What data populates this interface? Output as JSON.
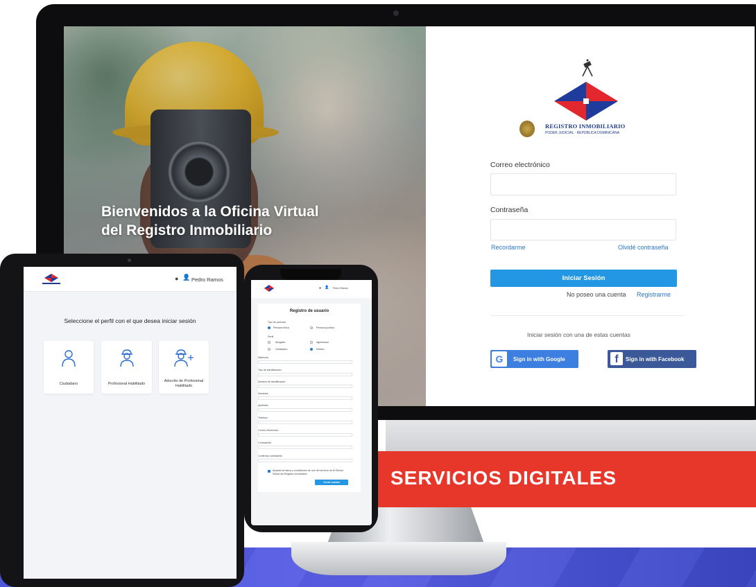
{
  "banner": {
    "text": "SERVICIOS DIGITALES"
  },
  "monitor": {
    "welcome_line1": "Bienvenidos a la Oficina Virtual",
    "welcome_line2": "del Registro Inmobiliario",
    "logo": {
      "title": "REGISTRO INMOBILIARIO",
      "subtitle": "PODER JUDICIAL · REPÚBLICA DOMINICANA"
    },
    "login": {
      "email_label": "Correo electrónico",
      "email_value": "",
      "password_label": "Contraseña",
      "password_value": "",
      "remember_label": "Recordarme",
      "forgot_label": "Olvidé contraseña",
      "submit_label": "Iniciar Sesión",
      "no_account_text": "No poseo una cuenta",
      "register_label": "Registrarme",
      "alt_login_text": "Iniciar sesión con una de estas cuentas",
      "google_label": "Sign in with Google",
      "facebook_label": "Sign in with Facebook"
    },
    "colors": {
      "primary": "#2396e4",
      "link": "#2a76c9",
      "banner": "#e7372b",
      "facebook": "#3b5998"
    }
  },
  "tablet": {
    "user_name": "Pedro Ramos",
    "heading": "Seleccione el perfil con el que desea iniciar sesión",
    "profiles": [
      {
        "icon": "person-icon",
        "label": "Ciudadano"
      },
      {
        "icon": "worker-icon",
        "label": "Profesional Habilitado"
      },
      {
        "icon": "add-worker-icon",
        "label": "Adscrito de Profesional Habilitado"
      }
    ]
  },
  "phone": {
    "user_name": "Pedro Ramos",
    "form_title": "Registro de usuario",
    "person_type_label": "Tipo de persona",
    "person_types": [
      {
        "label": "Persona física",
        "selected": true
      },
      {
        "label": "Persona jurídica",
        "selected": false
      }
    ],
    "profile_label": "Perfil",
    "profiles": [
      {
        "label": "Abogado",
        "selected": false
      },
      {
        "label": "Agrimensor",
        "selected": false
      },
      {
        "label": "Ciudadano",
        "selected": false
      },
      {
        "label": "Notario",
        "selected": true
      }
    ],
    "fields": [
      "Matrícula",
      "Tipo de identificación",
      "Número de identificación",
      "Nombres",
      "Apellidos",
      "Teléfono",
      "Correo electrónico",
      "Contraseña",
      "Confirmar contraseña"
    ],
    "terms_text": "Aceptar términos y condiciones de uso del servicio de la Oficina Virtual del Registro Inmobiliario",
    "submit_label": "Crear cuenta"
  }
}
